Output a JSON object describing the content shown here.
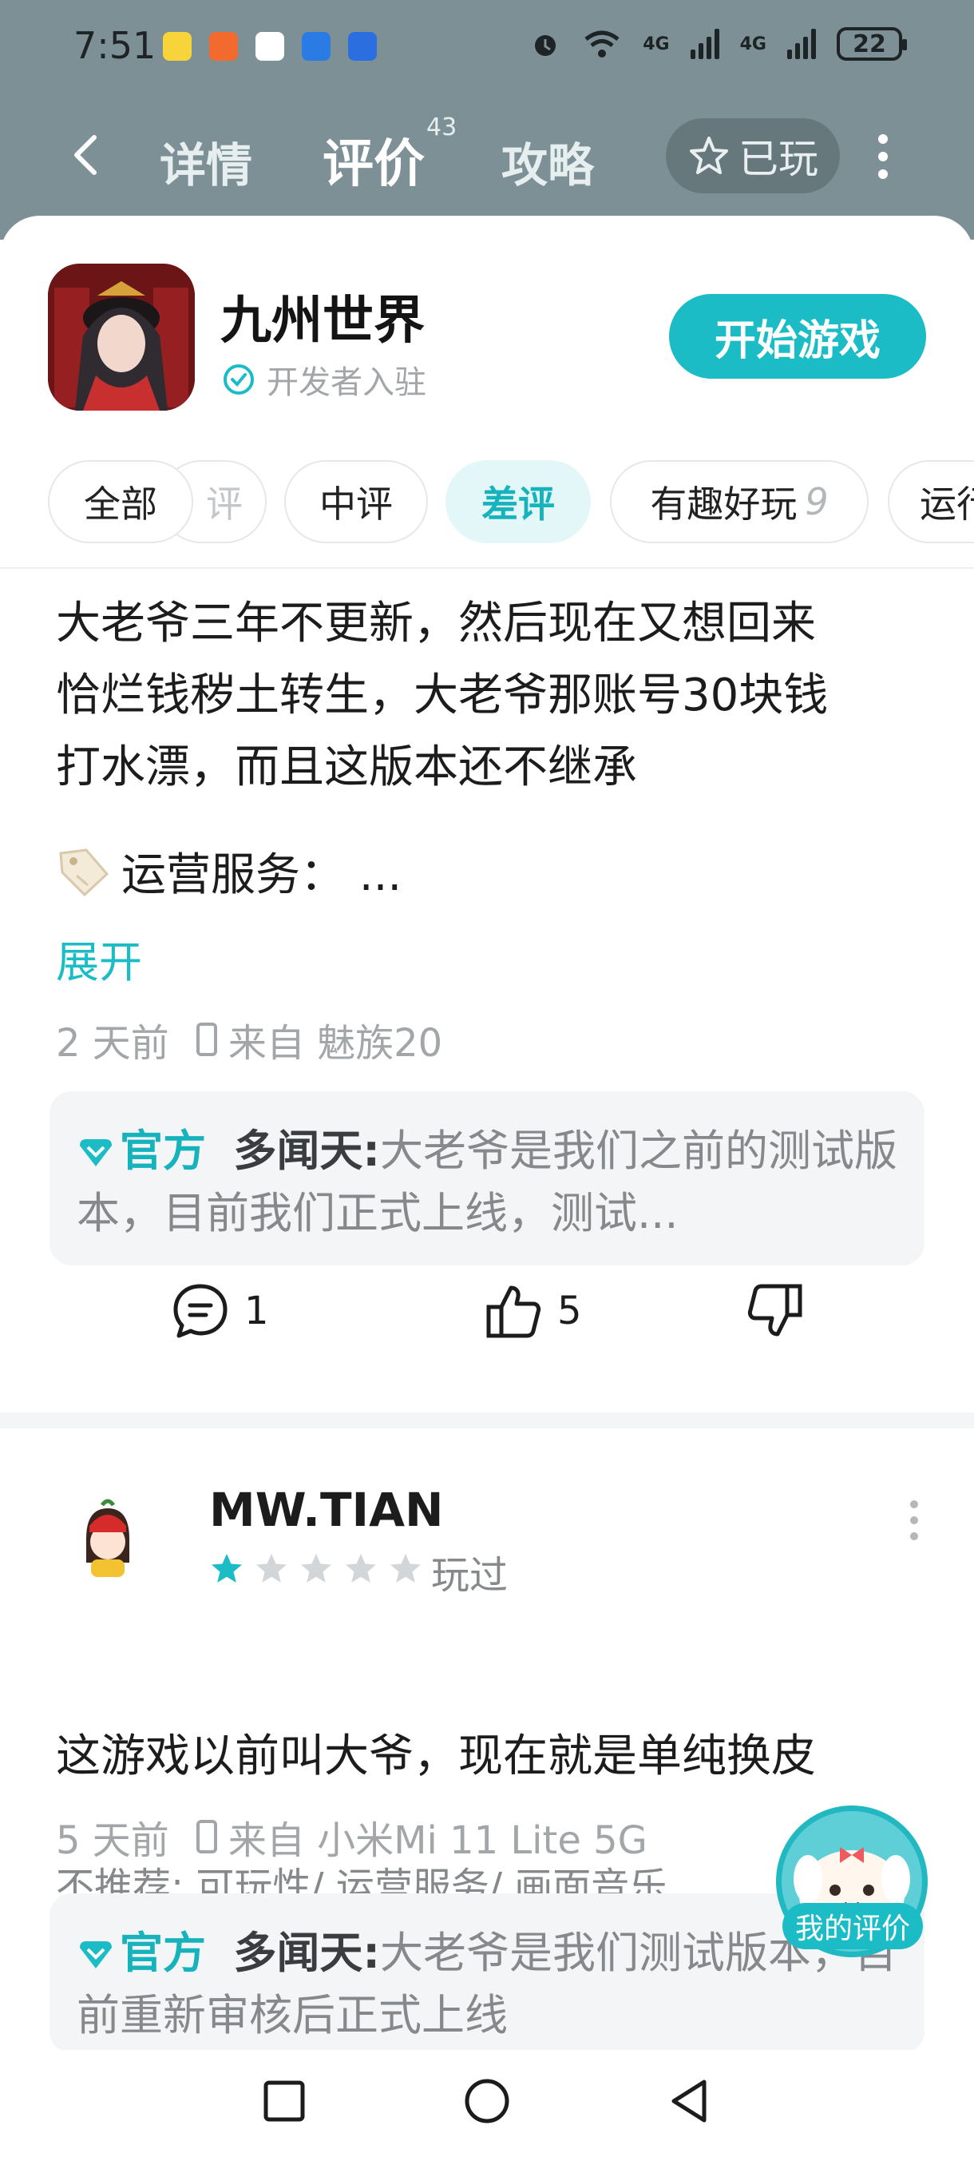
{
  "status_bar": {
    "time": "7:51",
    "battery": "22",
    "network_1": "4G",
    "network_2": "4G"
  },
  "nav": {
    "back_icon": "chevron-left-icon",
    "tabs": [
      {
        "label": "详情"
      },
      {
        "label": "评价",
        "badge": "43"
      },
      {
        "label": "攻略"
      }
    ],
    "played_label": "已玩"
  },
  "game": {
    "title": "九州世界",
    "developer_label": "开发者入驻",
    "start_button": "开始游戏"
  },
  "filters": {
    "all": "全部",
    "partial": "评",
    "mid": "中评",
    "bad": "差评",
    "fun": "有趣好玩",
    "fun_count": "9",
    "ops": "运行"
  },
  "review1": {
    "text_line1": "大老爷三年不更新，然后现在又想回来",
    "text_line2": "恰烂钱秽土转生，大老爷那账号30块钱",
    "text_line3": "打水漂，而且这版本还不继承",
    "tag_text": "运营服务：  ...",
    "expand": "展开",
    "time": "2 天前",
    "device": "来自 魅族20",
    "reply_official": "官方",
    "reply_name": "多闻天",
    "reply_sep": ":",
    "reply_text": "大老爷是我们之前的测试版本，目前我们正式上线，测试...",
    "comments": "1",
    "likes": "5"
  },
  "review2": {
    "user": "MW.TIAN",
    "rating": 1,
    "played": "玩过",
    "not_recommend": "不推荐: 可玩性/ 运营服务/ 画面音乐",
    "text": "这游戏以前叫大爷，现在就是单纯换皮",
    "time": "5 天前",
    "device": "来自 小米Mi 11 Lite 5G",
    "reply_official": "官方",
    "reply_name": "多闻天",
    "reply_sep": ":",
    "reply_text": "大老爷是我们测试版本，目前重新审核后正式上线"
  },
  "fab": {
    "label": "我的评价"
  },
  "colors": {
    "accent": "#1bbcc6",
    "header": "#7c9095",
    "star_on": "#1bbcc6",
    "star_off": "#d3d6d8"
  }
}
